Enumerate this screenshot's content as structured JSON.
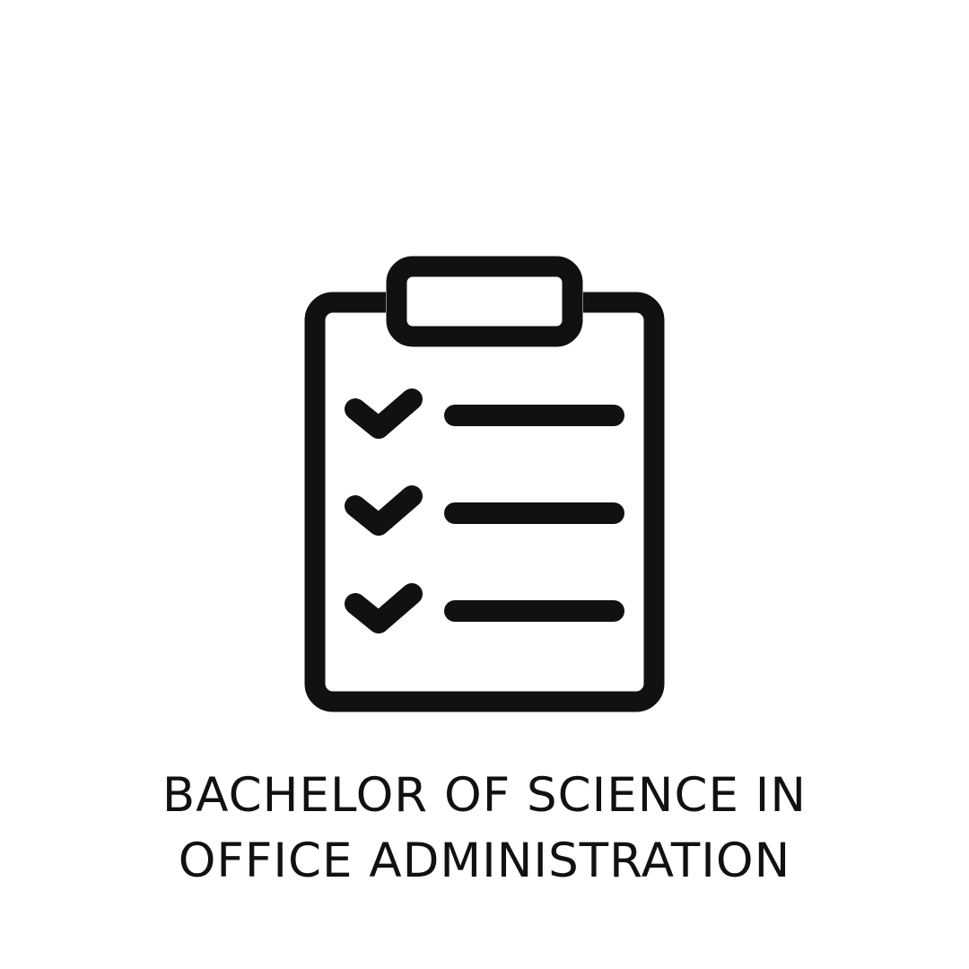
{
  "caption": {
    "line1": "BACHELOR OF SCIENCE IN",
    "line2": "OFFICE ADMINISTRATION"
  },
  "icon": {
    "name": "clipboard-checklist-icon",
    "stroke_color": "#111111",
    "checklist_items": 3
  },
  "colors": {
    "background": "#ffffff",
    "foreground": "#111111"
  }
}
